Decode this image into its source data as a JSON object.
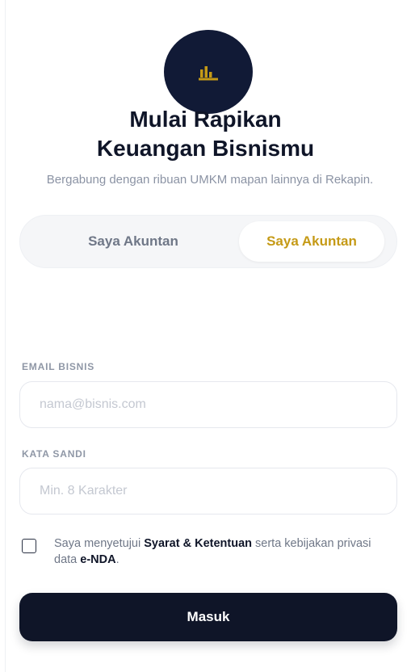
{
  "brand": {
    "logo_icon": "bar-chart-icon",
    "accent_color": "#c59a16",
    "dark_color": "#111a36"
  },
  "header": {
    "title_line1": "Mulai Rapikan",
    "title_line2": "Keuangan Bisnismu",
    "subtitle": "Bergabung dengan ribuan UMKM mapan lainnya di Rekapin."
  },
  "toggle": {
    "options": [
      "Saya Akuntan",
      "Saya Akuntan"
    ],
    "selected_index": 1
  },
  "form": {
    "email": {
      "label": "EMAIL BISNIS",
      "placeholder": "nama@bisnis.com",
      "value": ""
    },
    "password": {
      "label": "KATA SANDI",
      "placeholder": "Min. 8 Karakter",
      "value": ""
    },
    "consent": {
      "checked": false,
      "text_prefix": "Saya menyetujui",
      "terms_link": "Syarat & Ketentuan",
      "text_middle": "serta kebijakan privasi data",
      "nda_link": "e-NDA",
      "text_suffix": "."
    },
    "submit_label": "Masuk"
  }
}
